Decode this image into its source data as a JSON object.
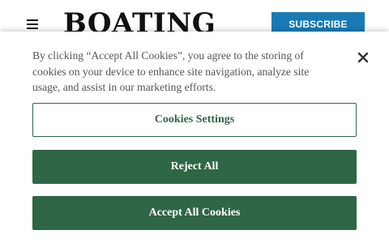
{
  "header": {
    "logo_text": "BOATING",
    "menu_icon": "hamburger-menu-icon",
    "subscribe_label": "SUBSCRIBE",
    "subscribe_color": "#1a7ab5"
  },
  "cookie_banner": {
    "message": "By clicking “Accept All Cookies”, you agree to the storing of cookies on your device to enhance site navigation, analyze site usage, and assist in our marketing efforts.",
    "close_icon": "close-icon",
    "settings_label": "Cookies Settings",
    "reject_label": "Reject All",
    "accept_label": "Accept All Cookies",
    "accent_color": "#2f6645"
  }
}
